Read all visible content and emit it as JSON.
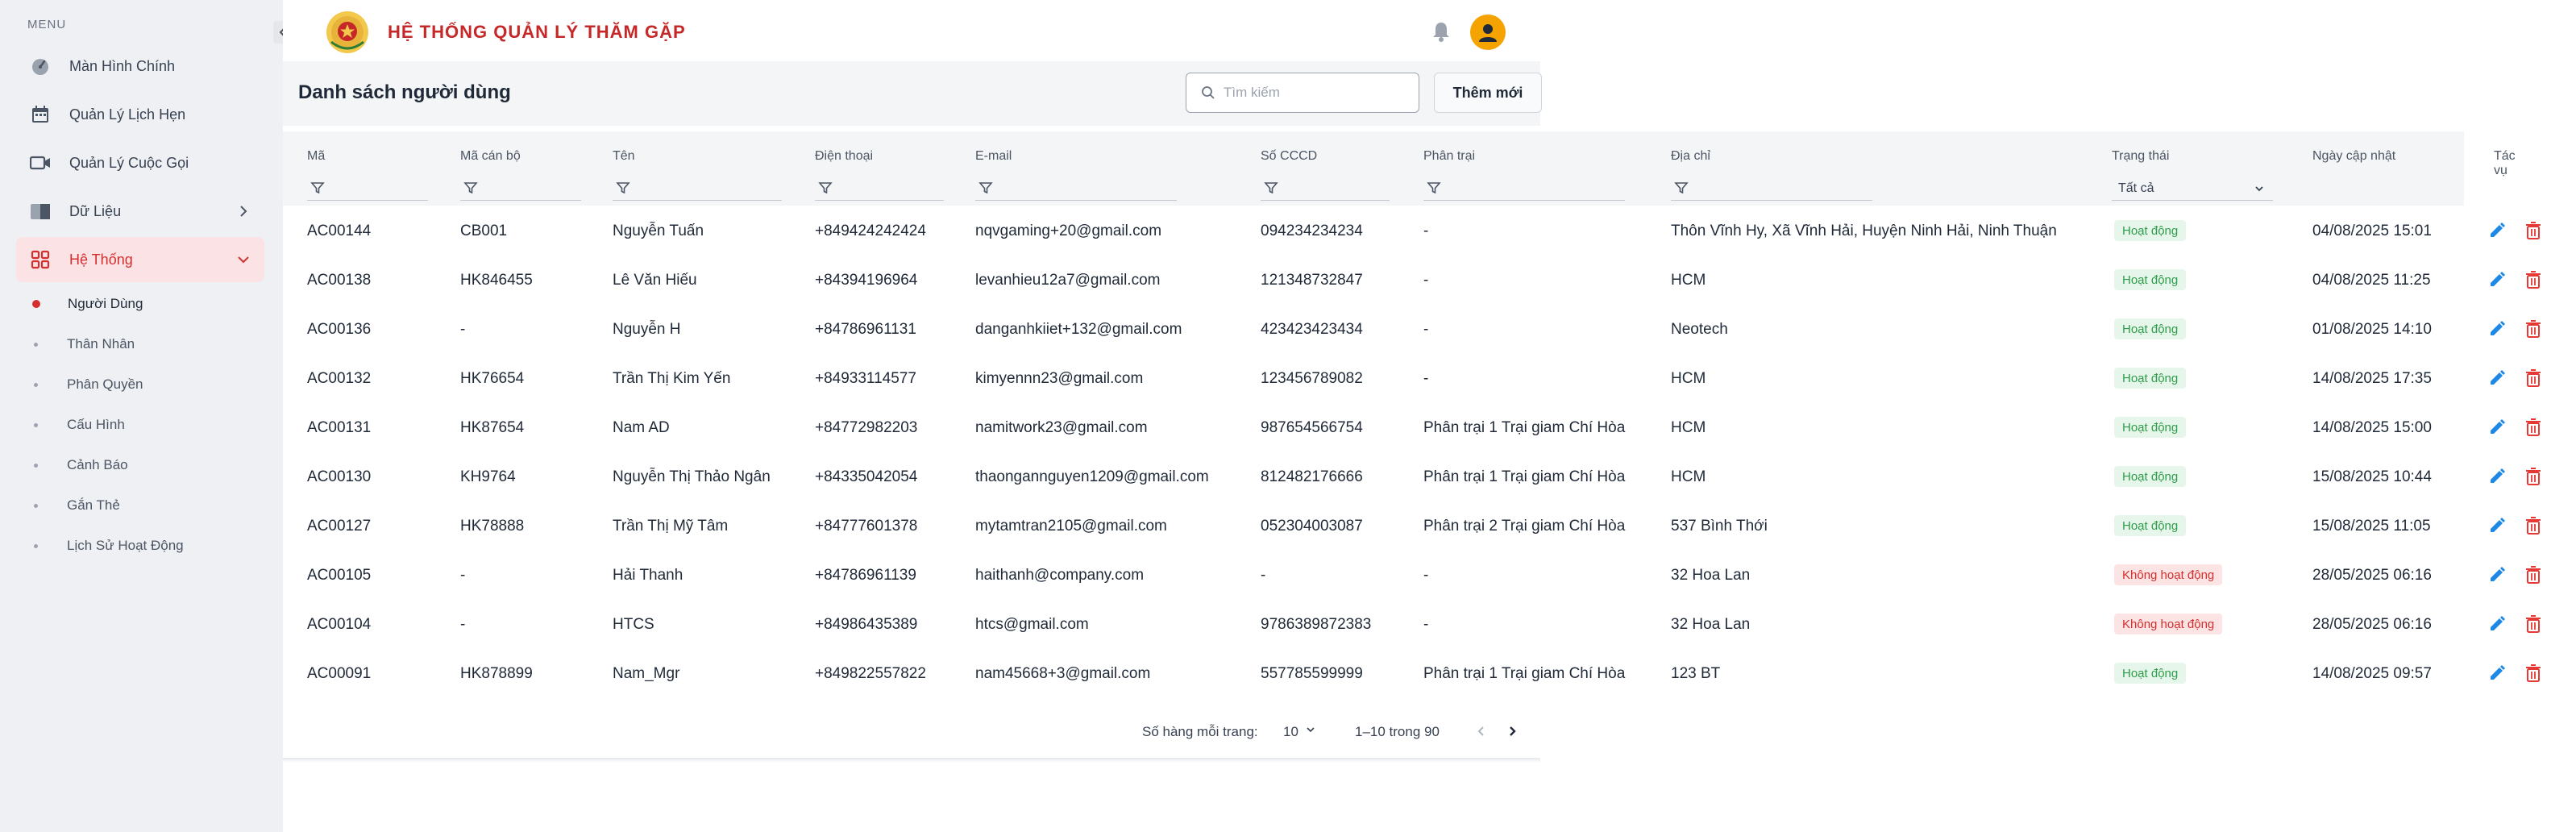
{
  "sidebar": {
    "menu_label": "MENU",
    "items": [
      {
        "label": "Màn Hình Chính",
        "icon": "gauge-icon"
      },
      {
        "label": "Quản Lý Lịch Hẹn",
        "icon": "calendar-icon"
      },
      {
        "label": "Quản Lý Cuộc Gọi",
        "icon": "video-icon"
      },
      {
        "label": "Dữ Liệu",
        "icon": "folder-icon"
      },
      {
        "label": "Hệ Thống",
        "icon": "grid-icon"
      }
    ],
    "subitems": [
      "Người Dùng",
      "Thân Nhân",
      "Phân Quyền",
      "Cấu Hình",
      "Cảnh Báo",
      "Gắn Thẻ",
      "Lịch Sử Hoạt Động"
    ]
  },
  "header": {
    "title": "HỆ THỐNG QUẢN LÝ THĂM GẶP"
  },
  "panel": {
    "title": "Danh sách người dùng",
    "search_placeholder": "Tìm kiếm",
    "add_label": "Thêm mới"
  },
  "table": {
    "columns": [
      "Mã",
      "Mã cán bộ",
      "Tên",
      "Điện thoại",
      "E-mail",
      "Số CCCD",
      "Phân trại",
      "Địa chỉ",
      "Trạng thái",
      "Ngày cập nhật",
      "Tác vụ"
    ],
    "status_filter": "Tất cả",
    "rows": [
      {
        "ma": "AC00144",
        "macb": "CB001",
        "ten": "Nguyễn Tuấn",
        "dt": "+849424242424",
        "email": "nqvgaming+20@gmail.com",
        "cccd": "094234234234",
        "phantrai": "-",
        "diachi": "Thôn Vĩnh Hy, Xã Vĩnh Hải, Huyện Ninh Hải, Ninh Thuận",
        "status": "Hoạt động",
        "active": true,
        "ngay": "04/08/2025 15:01"
      },
      {
        "ma": "AC00138",
        "macb": "HK846455",
        "ten": "Lê Văn Hiếu",
        "dt": "+84394196964",
        "email": "levanhieu12a7@gmail.com",
        "cccd": "121348732847",
        "phantrai": "-",
        "diachi": "HCM",
        "status": "Hoạt động",
        "active": true,
        "ngay": "04/08/2025 11:25"
      },
      {
        "ma": "AC00136",
        "macb": "-",
        "ten": "Nguyễn H",
        "dt": "+84786961131",
        "email": "danganhkiiet+132@gmail.com",
        "cccd": "423423423434",
        "phantrai": "-",
        "diachi": "Neotech",
        "status": "Hoạt động",
        "active": true,
        "ngay": "01/08/2025 14:10"
      },
      {
        "ma": "AC00132",
        "macb": "HK76654",
        "ten": "Trần Thị Kim Yến",
        "dt": "+84933114577",
        "email": "kimyennn23@gmail.com",
        "cccd": "123456789082",
        "phantrai": "-",
        "diachi": "HCM",
        "status": "Hoạt động",
        "active": true,
        "ngay": "14/08/2025 17:35"
      },
      {
        "ma": "AC00131",
        "macb": "HK87654",
        "ten": "Nam AD",
        "dt": "+84772982203",
        "email": "namitwork23@gmail.com",
        "cccd": "987654566754",
        "phantrai": "Phân trại 1 Trại giam Chí Hòa",
        "diachi": "HCM",
        "status": "Hoạt động",
        "active": true,
        "ngay": "14/08/2025 15:00"
      },
      {
        "ma": "AC00130",
        "macb": "KH9764",
        "ten": "Nguyễn Thị Thảo Ngân",
        "dt": "+84335042054",
        "email": "thaongannguyen1209@gmail.com",
        "cccd": "812482176666",
        "phantrai": "Phân trại 1 Trại giam Chí Hòa",
        "diachi": "HCM",
        "status": "Hoạt động",
        "active": true,
        "ngay": "15/08/2025 10:44"
      },
      {
        "ma": "AC00127",
        "macb": "HK78888",
        "ten": "Trần Thị Mỹ Tâm",
        "dt": "+84777601378",
        "email": "mytamtran2105@gmail.com",
        "cccd": "052304003087",
        "phantrai": "Phân trại 2 Trại giam Chí Hòa",
        "diachi": "537 Bình Thới",
        "status": "Hoạt động",
        "active": true,
        "ngay": "15/08/2025 11:05"
      },
      {
        "ma": "AC00105",
        "macb": "-",
        "ten": "Hải Thanh",
        "dt": "+84786961139",
        "email": "haithanh@company.com",
        "cccd": "-",
        "phantrai": "-",
        "diachi": "32 Hoa Lan",
        "status": "Không hoạt động",
        "active": false,
        "ngay": "28/05/2025 06:16"
      },
      {
        "ma": "AC00104",
        "macb": "-",
        "ten": "HTCS",
        "dt": "+84986435389",
        "email": "htcs@gmail.com",
        "cccd": "9786389872383",
        "phantrai": "-",
        "diachi": "32 Hoa Lan",
        "status": "Không hoạt động",
        "active": false,
        "ngay": "28/05/2025 06:16"
      },
      {
        "ma": "AC00091",
        "macb": "HK878899",
        "ten": "Nam_Mgr",
        "dt": "+849822557822",
        "email": "nam45668+3@gmail.com",
        "cccd": "557785599999",
        "phantrai": "Phân trại 1 Trại giam Chí Hòa",
        "diachi": "123 BT",
        "status": "Hoạt động",
        "active": true,
        "ngay": "14/08/2025 09:57"
      }
    ]
  },
  "pagination": {
    "rows_per_page_label": "Số hàng mỗi trang:",
    "rows_per_page": "10",
    "range": "1–10 trong 90"
  },
  "colors": {
    "accent": "#d32f2f",
    "active_badge_bg": "#e6f6ea",
    "active_badge_text": "#2e9d4a",
    "inactive_badge_bg": "#fde4e4",
    "edit_icon": "#1e88e5",
    "delete_icon": "#e53935",
    "avatar": "#f5a300"
  }
}
